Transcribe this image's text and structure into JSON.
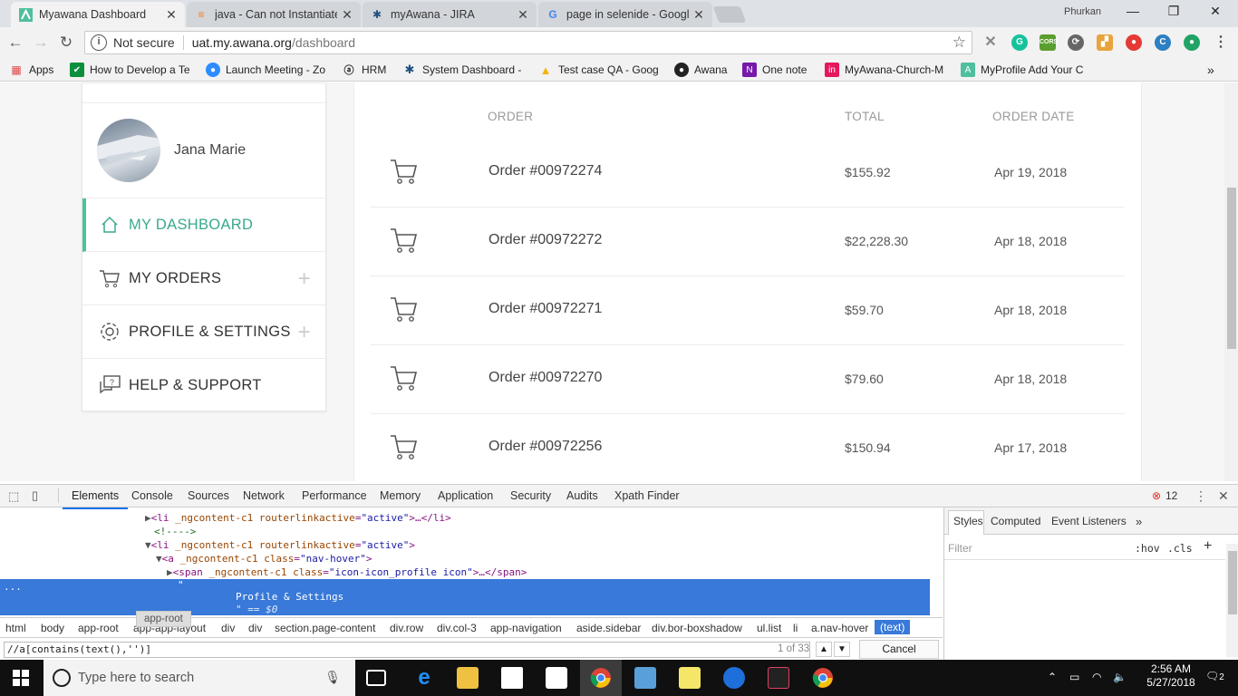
{
  "browser": {
    "tabs": [
      {
        "title": "Myawana Dashboard",
        "icon": "awana-icon",
        "active": true
      },
      {
        "title": "java - Can not Instantiate",
        "icon": "stackoverflow-icon",
        "active": false
      },
      {
        "title": "myAwana - JIRA",
        "icon": "jira-icon",
        "active": false
      },
      {
        "title": "page in selenide - Google",
        "icon": "google-icon",
        "active": false
      }
    ],
    "user": "Phurkan",
    "address": {
      "security": "Not secure",
      "host": "uat.my.awana.org",
      "path": "/dashboard"
    },
    "bookmarks": [
      {
        "label": "Apps",
        "icon": "apps-grid-icon"
      },
      {
        "label": "How to Develop a Te",
        "icon": "check-icon"
      },
      {
        "label": "Launch Meeting - Zo",
        "icon": "zoom-icon"
      },
      {
        "label": "HRM",
        "icon": "amazon-icon"
      },
      {
        "label": "System Dashboard -",
        "icon": "jira-icon"
      },
      {
        "label": "Test case QA - Goog",
        "icon": "drive-icon"
      },
      {
        "label": "Awana",
        "icon": "github-icon"
      },
      {
        "label": "One note",
        "icon": "onenote-icon"
      },
      {
        "label": "MyAwana-Church-M",
        "icon": "invision-icon"
      },
      {
        "label": "MyProfile Add Your C",
        "icon": "awana-icon"
      }
    ]
  },
  "sidebar": {
    "profile_name": "Jana Marie",
    "items": [
      {
        "label": "MY DASHBOARD",
        "active": true
      },
      {
        "label": "MY ORDERS",
        "expandable": true
      },
      {
        "label": "PROFILE & SETTINGS",
        "expandable": true
      },
      {
        "label": "HELP & SUPPORT"
      }
    ],
    "expand_symbol": "+"
  },
  "orders": {
    "headers": {
      "order": "ORDER",
      "total": "TOTAL",
      "date": "ORDER DATE"
    },
    "rows": [
      {
        "name": "Order #00972274",
        "total": "$155.92",
        "date": "Apr 19, 2018"
      },
      {
        "name": "Order #00972272",
        "total": "$22,228.30",
        "date": "Apr 18, 2018"
      },
      {
        "name": "Order #00972271",
        "total": "$59.70",
        "date": "Apr 18, 2018"
      },
      {
        "name": "Order #00972270",
        "total": "$79.60",
        "date": "Apr 18, 2018"
      },
      {
        "name": "Order #00972256",
        "total": "$150.94",
        "date": "Apr 17, 2018"
      }
    ]
  },
  "devtools": {
    "tabs": [
      "Elements",
      "Console",
      "Sources",
      "Network",
      "Performance",
      "Memory",
      "Application",
      "Security",
      "Audits",
      "Xpath Finder"
    ],
    "error_count": "12",
    "code": {
      "line1": {
        "open": "<li ",
        "attr1": "_ngcontent-c1 ",
        "attr2": "routerlinkactive",
        "eq": "=",
        "val": "\"active\"",
        "rest": ">…</li>"
      },
      "line2": "<!---->",
      "line3": {
        "open": "<li ",
        "attr1": "_ngcontent-c1 ",
        "attr2": "routerlinkactive",
        "eq": "=",
        "val": "\"active\"",
        "rest": ">"
      },
      "line4": {
        "open": "<a ",
        "attr1": "_ngcontent-c1 ",
        "attr2": "class",
        "eq": "=",
        "val": "\"nav-hover\"",
        "rest": ">"
      },
      "line5": {
        "open": "<span ",
        "attr1": "_ngcontent-c1 ",
        "attr2": "class",
        "eq": "=",
        "val": "\"icon-icon_profile icon\"",
        "rest": ">…</span>"
      },
      "hl_quote": "\"",
      "hl_text": "Profile & Settings",
      "hl_eq": "\" == $0",
      "hl_dots": "..."
    },
    "breadcrumbs": [
      "html",
      "body",
      "app-root",
      "app-app-layout",
      "div",
      "div",
      "section.page-content",
      "div.row",
      "div.col-3",
      "app-navigation",
      "aside.sidebar",
      "div.bor-boxshadow",
      "ul.list",
      "li",
      "a.nav-hover",
      "(text)"
    ],
    "tooltip": "app-root",
    "search": {
      "value": "//a[contains(text(),'')]",
      "count": "1 of 33",
      "cancel": "Cancel"
    },
    "styles_tabs": [
      "Styles",
      "Computed",
      "Event Listeners"
    ],
    "filter_placeholder": "Filter",
    "hov": ":hov",
    "cls": ".cls"
  },
  "taskbar": {
    "search_placeholder": "Type here to search",
    "time": "2:56 AM",
    "date": "5/27/2018",
    "notifications": "2"
  }
}
